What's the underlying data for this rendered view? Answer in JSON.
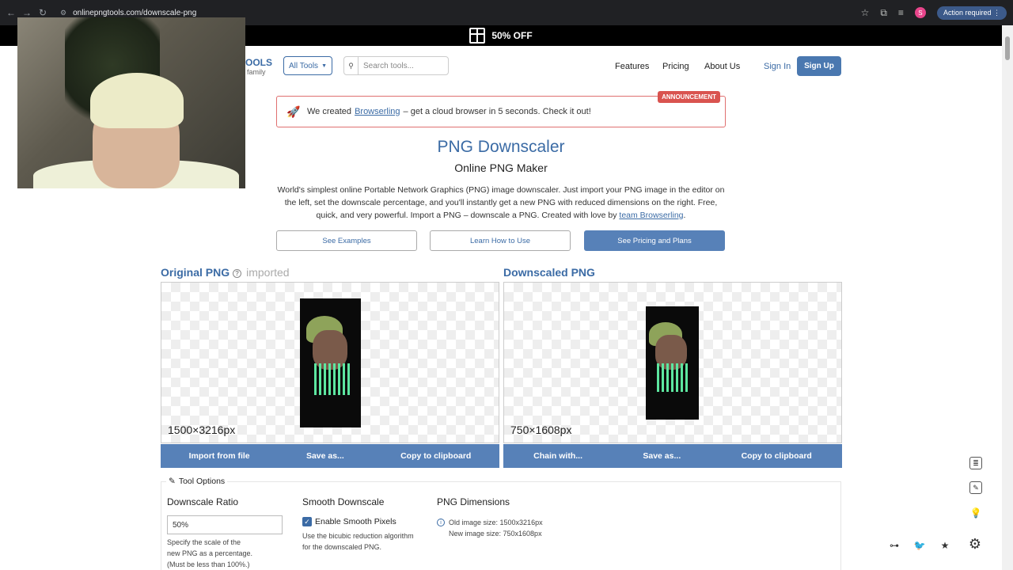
{
  "browser": {
    "url": "onlinepngtools.com/downscale-png",
    "profile_initial": "S",
    "action_label": "Action required"
  },
  "promo": {
    "text": "50% OFF"
  },
  "header": {
    "logo_fragment": "OOLS",
    "logo_sub": "family",
    "all_tools": "All Tools",
    "search_placeholder": "Search tools...",
    "nav": [
      "Features",
      "Pricing",
      "About Us"
    ],
    "sign_in": "Sign In",
    "sign_up": "Sign Up"
  },
  "announcement": {
    "prefix": "We created",
    "link": "Browserling",
    "suffix": "– get a cloud browser in 5 seconds. Check it out!",
    "tag": "ANNOUNCEMENT"
  },
  "hero": {
    "title": "PNG Downscaler",
    "subtitle": "Online PNG Maker",
    "description": "World's simplest online Portable Network Graphics (PNG) image downscaler. Just import your PNG image in the editor on the left, set the downscale percentage, and you'll instantly get a new PNG with reduced dimensions on the right. Free, quick, and very powerful. Import a PNG – downscale a PNG. Created with love by",
    "description_link": "team Browserling",
    "buttons": {
      "examples": "See Examples",
      "learn": "Learn How to Use",
      "pricing": "See Pricing and Plans"
    }
  },
  "original": {
    "title": "Original PNG",
    "status": "imported",
    "dims": "1500×3216px",
    "actions": [
      "Import from file",
      "Save as...",
      "Copy to clipboard"
    ]
  },
  "downscaled": {
    "title": "Downscaled PNG",
    "dims": "750×1608px",
    "actions": [
      "Chain with...",
      "Save as...",
      "Copy to clipboard"
    ]
  },
  "tool_options": {
    "legend": "Tool Options",
    "ratio": {
      "heading": "Downscale Ratio",
      "value": "50%",
      "help": [
        "Specify the scale of the",
        "new PNG as a percentage.",
        "(Must be less than 100%.)"
      ]
    },
    "smooth": {
      "heading": "Smooth Downscale",
      "checkbox_label": "Enable Smooth Pixels",
      "checked": true,
      "help": [
        "Use the bicubic reduction algorithm",
        "for the downscaled PNG."
      ]
    },
    "dimensions": {
      "heading": "PNG Dimensions",
      "old": "Old image size: 1500x3216px",
      "new": "New image size: 750x1608px"
    }
  },
  "colors": {
    "brand": "#3b6ba5",
    "button": "#5781b8",
    "announce_tag": "#d9534f"
  }
}
